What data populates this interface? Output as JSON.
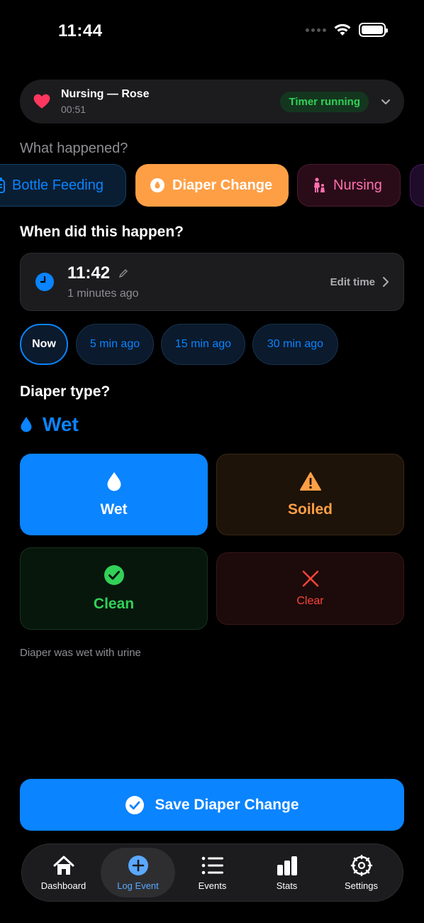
{
  "status_bar": {
    "time": "11:44"
  },
  "timer_banner": {
    "title": "Nursing — Rose",
    "elapsed": "00:51",
    "badge": "Timer running"
  },
  "event_section": {
    "label": "What happened?",
    "chips": [
      {
        "label": "Bottle Feeding",
        "icon": "bottle-icon"
      },
      {
        "label": "Diaper Change",
        "icon": "droplet-icon",
        "selected": true
      },
      {
        "label": "Nursing",
        "icon": "nursing-icon"
      }
    ]
  },
  "time_section": {
    "heading": "When did this happen?",
    "time": "11:42",
    "ago": "1 minutes ago",
    "edit_label": "Edit time",
    "quick_options": [
      "Now",
      "5 min ago",
      "15 min ago",
      "30 min ago"
    ]
  },
  "diaper_section": {
    "heading": "Diaper type?",
    "selected_label": "Wet",
    "options": {
      "wet": "Wet",
      "soiled": "Soiled",
      "clean": "Clean",
      "clear": "Clear"
    },
    "description": "Diaper was wet with urine"
  },
  "save_button": {
    "label": "Save Diaper Change"
  },
  "tab_bar": {
    "tabs": [
      {
        "label": "Dashboard",
        "icon": "home-icon"
      },
      {
        "label": "Log Event",
        "icon": "plus-circle-icon",
        "active": true
      },
      {
        "label": "Events",
        "icon": "list-icon"
      },
      {
        "label": "Stats",
        "icon": "bar-chart-icon"
      },
      {
        "label": "Settings",
        "icon": "gear-icon"
      }
    ]
  },
  "colors": {
    "accent": "#0a84ff",
    "diaper_orange": "#ff9f45",
    "success_green": "#32d158",
    "danger_red": "#ff453a",
    "nursing_pink": "#ff6fae"
  }
}
